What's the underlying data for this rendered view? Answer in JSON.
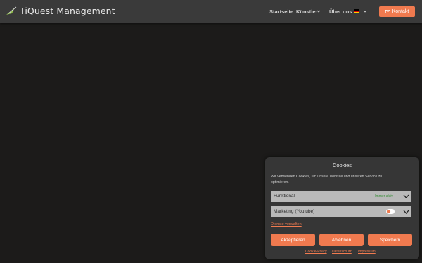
{
  "header": {
    "title": "TiQuest Management",
    "nav": [
      {
        "label": "Startseite"
      },
      {
        "label": "Künstler"
      },
      {
        "label": "Über uns"
      }
    ],
    "contact_label": "Kontakt"
  },
  "cookie": {
    "title": "Cookies",
    "text": "Wir verwenden Cookies, um unsere Website und unseren Service zu optimieren.",
    "categories": [
      {
        "label": "Funktional",
        "status": "Immer aktiv"
      },
      {
        "label": "Marketing (Youtube)"
      }
    ],
    "manage_link": "Dienste verwalten",
    "buttons": {
      "accept": "Akzeptieren",
      "deny": "Ablehnen",
      "save": "Speichern"
    },
    "footer_links": [
      "Cookie-Policy",
      "Datenschutz",
      "Impressum"
    ]
  },
  "colors": {
    "accent": "#f07a4f",
    "header_bg": "#3a3a3a",
    "page_bg": "#1c1b1a"
  }
}
